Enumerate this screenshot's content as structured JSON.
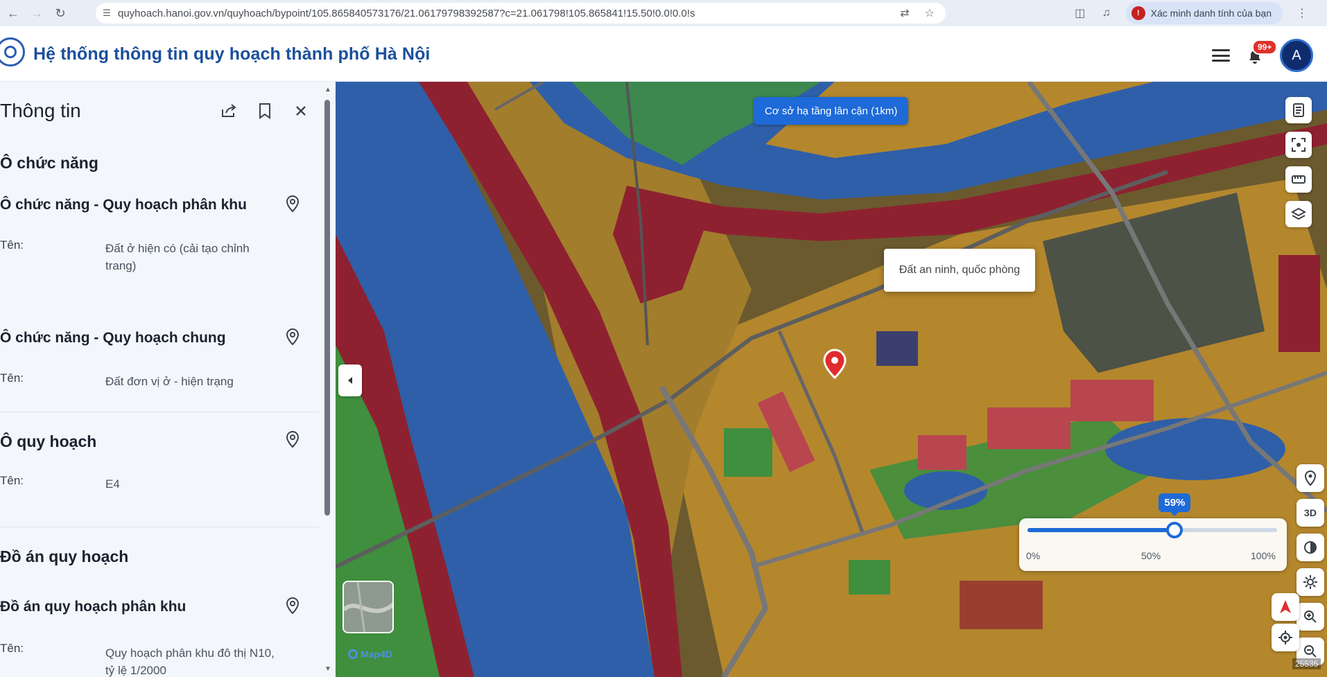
{
  "browser": {
    "url": "quyhoach.hanoi.gov.vn/quyhoach/bypoint/105.865840573176/21.06179798392587?c=21.061798!105.865841!15.50!0.0!0.0!s",
    "verify_label": "Xác minh danh tính của bạn",
    "icons": [
      "back-icon",
      "forward-icon",
      "reload-icon",
      "site-settings-icon",
      "translate-icon",
      "bookmark-star-icon",
      "extensions-icon",
      "media-icon",
      "kebab-menu-icon"
    ]
  },
  "header": {
    "title": "Hệ thống thông tin quy hoạch thành phố Hà Nội",
    "notification_badge": "99+",
    "avatar_initial": "A",
    "brand_color": "#1b4f9c"
  },
  "panel": {
    "title": "Thông tin",
    "sections": {
      "land_function": {
        "title": "Ô chức năng",
        "zoning": {
          "title": "Ô chức năng - Quy hoạch phân khu",
          "label": "Tên:",
          "value": "Đất ở hiện có (cải tạo chỉnh trang)"
        },
        "general": {
          "title": "Ô chức năng - Quy hoạch chung",
          "label": "Tên:",
          "value": "Đất đơn vị ở - hiện trạng"
        }
      },
      "plan_cell": {
        "title": "Ô quy hoạch",
        "label": "Tên:",
        "value": "E4"
      },
      "project": {
        "title": "Đồ án quy hoạch",
        "zoning": {
          "title": "Đồ án quy hoạch phân khu",
          "label": "Tên:",
          "value": "Quy hoạch phân khu đô thị N10, tỷ lệ 1/2000"
        }
      }
    }
  },
  "map": {
    "infra_button": "Cơ sở hạ tầng lân cận (1km)",
    "tooltip": "Đất an ninh, quốc phòng",
    "brand": "Map4D",
    "scale": "25535",
    "btn_3d": "3D",
    "opacity": {
      "value_percent": 59,
      "value_label": "59%",
      "ticks": [
        "0%",
        "50%",
        "100%"
      ]
    },
    "colors": {
      "water": "#2f5fa8",
      "security_land": "#8e2130",
      "residential": "#b4872d",
      "green": "#3f8f3e",
      "accent": "#1e6ad8"
    }
  }
}
